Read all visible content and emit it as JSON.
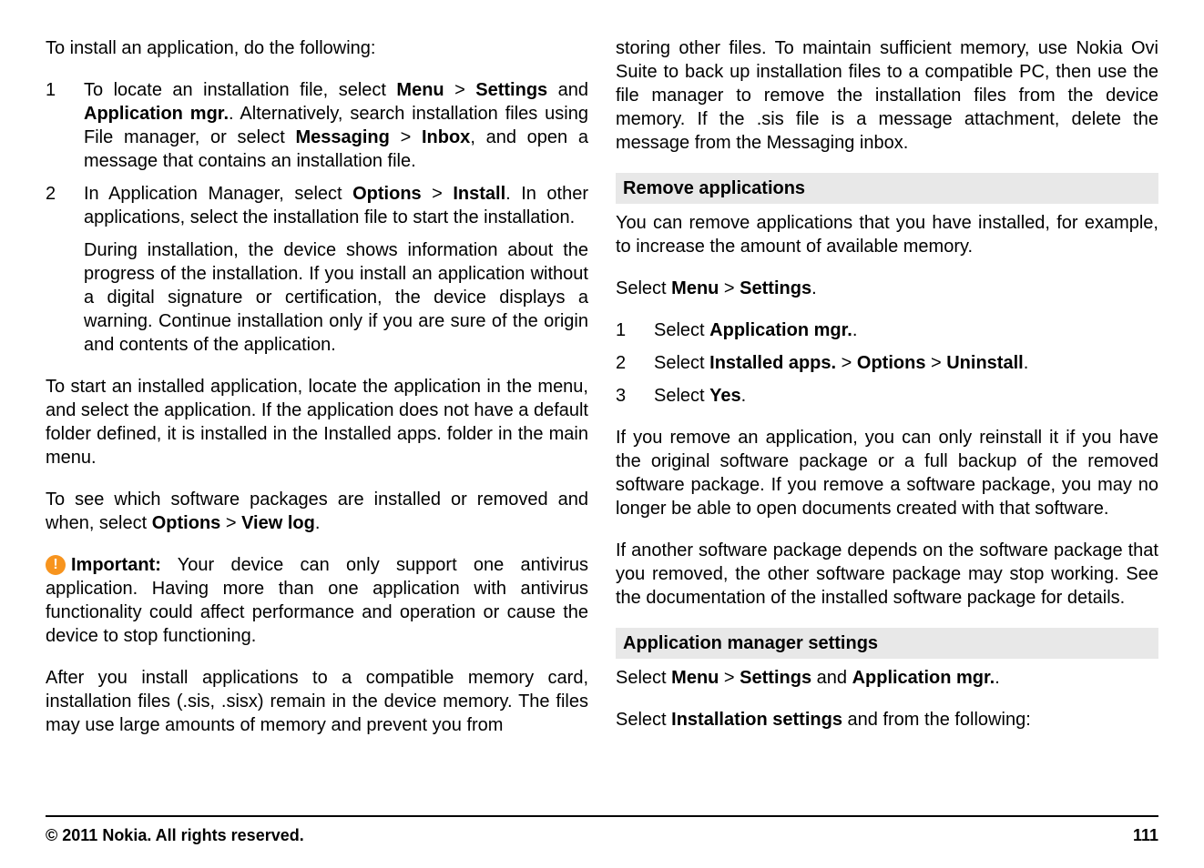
{
  "left": {
    "intro": "To install an application, do the following:",
    "steps": [
      {
        "num": "1",
        "parts": [
          {
            "text": "To locate an installation file, select ",
            "bold": false
          },
          {
            "text": "Menu",
            "bold": true
          },
          {
            "text": " > ",
            "bold": false
          },
          {
            "text": "Settings",
            "bold": true
          },
          {
            "text": " and ",
            "bold": false
          },
          {
            "text": "Application mgr.",
            "bold": true
          },
          {
            "text": ". Alternatively, search installation files using File manager, or select ",
            "bold": false
          },
          {
            "text": "Messaging",
            "bold": true
          },
          {
            "text": " > ",
            "bold": false
          },
          {
            "text": "Inbox",
            "bold": true
          },
          {
            "text": ", and open a message that contains an installation file.",
            "bold": false
          }
        ]
      },
      {
        "num": "2",
        "parts": [
          {
            "text": "In Application Manager, select ",
            "bold": false
          },
          {
            "text": "Options",
            "bold": true
          },
          {
            "text": " > ",
            "bold": false
          },
          {
            "text": "Install",
            "bold": true
          },
          {
            "text": ". In other applications, select the installation file to start the installation.",
            "bold": false
          }
        ],
        "sub": "During installation, the device shows information about the progress of the installation. If you install an application without a digital signature or certification, the device displays a warning. Continue installation only if you are sure of the origin and contents of the application."
      }
    ],
    "para3": "To start an installed application, locate the application in the menu, and select the application. If the application does not have a default folder defined, it is installed in the Installed apps. folder in the main menu.",
    "para4_parts": [
      {
        "text": "To see which software packages are installed or removed and when, select ",
        "bold": false
      },
      {
        "text": "Options",
        "bold": true
      },
      {
        "text": " > ",
        "bold": false
      },
      {
        "text": "View log",
        "bold": true
      },
      {
        "text": ".",
        "bold": false
      }
    ],
    "important_label": "Important:",
    "important_text": " Your device can only support one antivirus application. Having more than one application with antivirus functionality could affect performance and operation or cause the device to stop functioning.",
    "para6": "After you install applications to a compatible memory card, installation files (.sis, .sisx) remain in the device memory. The files may use large amounts of memory and prevent you from"
  },
  "right": {
    "para_cont": "storing other files. To maintain sufficient memory, use Nokia Ovi Suite to back up installation files to a compatible PC, then use the file manager to remove the installation files from the device memory. If the .sis file is a message attachment, delete the message from the Messaging inbox.",
    "section1_header": "Remove applications",
    "section1_intro": "You can remove applications that you have installed, for example, to increase the amount of available memory.",
    "section1_select_parts": [
      {
        "text": "Select ",
        "bold": false
      },
      {
        "text": "Menu",
        "bold": true
      },
      {
        "text": " > ",
        "bold": false
      },
      {
        "text": "Settings",
        "bold": true
      },
      {
        "text": ".",
        "bold": false
      }
    ],
    "section1_steps": [
      {
        "num": "1",
        "parts": [
          {
            "text": "Select ",
            "bold": false
          },
          {
            "text": "Application mgr.",
            "bold": true
          },
          {
            "text": ".",
            "bold": false
          }
        ]
      },
      {
        "num": "2",
        "parts": [
          {
            "text": "Select ",
            "bold": false
          },
          {
            "text": "Installed apps.",
            "bold": true
          },
          {
            "text": " > ",
            "bold": false
          },
          {
            "text": "Options",
            "bold": true
          },
          {
            "text": " > ",
            "bold": false
          },
          {
            "text": "Uninstall",
            "bold": true
          },
          {
            "text": ".",
            "bold": false
          }
        ]
      },
      {
        "num": "3",
        "parts": [
          {
            "text": "Select ",
            "bold": false
          },
          {
            "text": "Yes",
            "bold": true
          },
          {
            "text": ".",
            "bold": false
          }
        ]
      }
    ],
    "section1_para2": "If you remove an application, you can only reinstall it if you have the original software package or a full backup of the removed software package. If you remove a software package, you may no longer be able to open documents created with that software.",
    "section1_para3": "If another software package depends on the software package that you removed, the other software package may stop working. See the documentation of the installed software package for details.",
    "section2_header": "Application manager settings",
    "section2_select_parts": [
      {
        "text": "Select ",
        "bold": false
      },
      {
        "text": "Menu",
        "bold": true
      },
      {
        "text": " > ",
        "bold": false
      },
      {
        "text": "Settings",
        "bold": true
      },
      {
        "text": " and ",
        "bold": false
      },
      {
        "text": "Application mgr.",
        "bold": true
      },
      {
        "text": ".",
        "bold": false
      }
    ],
    "section2_para2_parts": [
      {
        "text": "Select ",
        "bold": false
      },
      {
        "text": "Installation settings",
        "bold": true
      },
      {
        "text": " and from the following:",
        "bold": false
      }
    ]
  },
  "footer": {
    "copyright": "© 2011 Nokia. All rights reserved.",
    "page": "111"
  }
}
